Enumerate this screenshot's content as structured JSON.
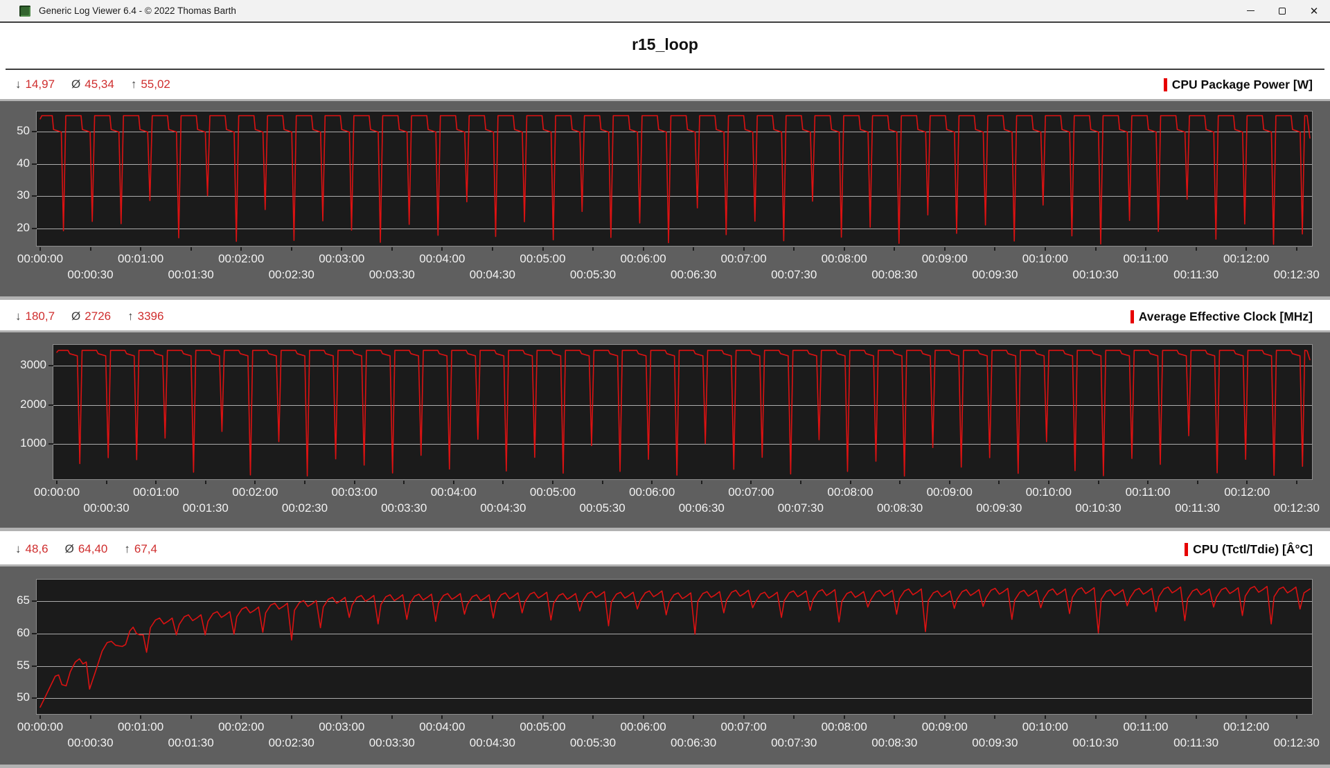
{
  "window": {
    "title": "Generic Log Viewer 6.4 - © 2022 Thomas Barth",
    "close_glyph": "✕"
  },
  "header": {
    "title": "r15_loop"
  },
  "stat_symbols": {
    "min": "↓",
    "avg": "Ø",
    "max": "↑"
  },
  "chart_data": [
    {
      "type": "line",
      "title": "CPU Package Power [W]",
      "stats": {
        "min": "14,97",
        "avg": "45,34",
        "max": "55,02"
      },
      "legend_color": "#e60000",
      "line_color": "#dc1212",
      "ylim": [
        14.5,
        56.3
      ],
      "yticks": [
        20,
        30,
        40,
        50
      ],
      "x_max_s": 758,
      "x_tick_interval_s": 30,
      "x_row1_labels": [
        "00:00:00",
        "00:01:00",
        "00:02:00",
        "00:03:00",
        "00:04:00",
        "00:05:00",
        "00:06:00",
        "00:07:00",
        "00:08:00",
        "00:09:00",
        "00:10:00",
        "00:11:00",
        "00:12:00"
      ],
      "x_row2_labels": [
        "00:00:30",
        "00:01:30",
        "00:02:30",
        "00:03:30",
        "00:04:30",
        "00:05:30",
        "00:06:30",
        "00:07:30",
        "00:08:30",
        "00:09:30",
        "00:10:30",
        "00:11:30",
        "00:12:30"
      ],
      "series": [
        {
          "name": "CPU Package Power",
          "lead": [
            [
              0,
              54.0
            ]
          ],
          "cycle": {
            "t0": 1.0,
            "period": 17.2,
            "count": 44,
            "shape": [
              [
                0,
                "c",
                55.0
              ],
              [
                6.2,
                "c",
                55.0
              ],
              [
                7.0,
                "c",
                50.7
              ],
              [
                11.6,
                "c",
                49.9
              ],
              [
                12.9,
                "d",
                0
              ],
              [
                14.3,
                "c",
                55.0
              ]
            ],
            "dips": [
              19.2,
              22.1,
              21.4,
              28.6,
              17.0,
              30.1,
              15.9,
              25.8,
              16.2,
              22.3,
              19.4,
              15.6,
              21.2,
              17.8,
              28.2,
              17.4,
              22.0,
              16.4,
              25.2,
              17.1,
              21.6,
              15.5,
              26.3,
              18.0,
              22.2,
              16.1,
              28.4,
              17.2,
              20.3,
              15.3,
              24.1,
              18.4,
              21.0,
              16.0,
              27.2,
              17.6,
              15.1,
              22.4,
              19.0,
              29.0,
              16.6,
              21.3,
              15.0,
              18.2
            ]
          },
          "tail": [
            [
              756.3,
              55.0
            ],
            [
              758,
              48.0
            ]
          ]
        }
      ]
    },
    {
      "type": "line",
      "title": "Average Effective Clock [MHz]",
      "stats": {
        "min": "180,7",
        "avg": "2726",
        "max": "3396"
      },
      "legend_color": "#e60000",
      "line_color": "#dc1212",
      "ylim": [
        100,
        3530
      ],
      "yticks": [
        1000,
        2000,
        3000
      ],
      "x_max_s": 758,
      "x_tick_interval_s": 30,
      "x_row1_labels": [
        "00:00:00",
        "00:01:00",
        "00:02:00",
        "00:03:00",
        "00:04:00",
        "00:05:00",
        "00:06:00",
        "00:07:00",
        "00:08:00",
        "00:09:00",
        "00:10:00",
        "00:11:00",
        "00:12:00"
      ],
      "x_row2_labels": [
        "00:00:30",
        "00:01:30",
        "00:02:30",
        "00:03:30",
        "00:04:30",
        "00:05:30",
        "00:06:30",
        "00:07:30",
        "00:08:30",
        "00:09:30",
        "00:10:30",
        "00:11:30",
        "00:12:30"
      ],
      "series": [
        {
          "name": "Average Effective Clock",
          "lead": [
            [
              0,
              3340
            ]
          ],
          "cycle": {
            "t0": 1.0,
            "period": 17.2,
            "count": 44,
            "shape": [
              [
                0,
                "c",
                3390
              ],
              [
                5.8,
                "c",
                3390
              ],
              [
                6.8,
                "c",
                3305
              ],
              [
                11.4,
                "c",
                3250
              ],
              [
                12.9,
                "d",
                0
              ],
              [
                14.3,
                "c",
                3390
              ]
            ],
            "dips": [
              500,
              650,
              600,
              1150,
              280,
              1320,
              210,
              1060,
              185,
              620,
              460,
              260,
              710,
              360,
              1120,
              310,
              660,
              255,
              960,
              300,
              610,
              205,
              1010,
              355,
              660,
              235,
              1110,
              300,
              560,
              181,
              910,
              410,
              650,
              250,
              1060,
              320,
              190,
              630,
              480,
              1210,
              265,
              610,
              200,
              430
            ]
          },
          "tail": [
            [
              756.3,
              3380
            ],
            [
              758,
              3150
            ]
          ]
        }
      ]
    },
    {
      "type": "line",
      "title": "CPU (Tctl/Tdie) [Â°C]",
      "stats": {
        "min": "48,6",
        "avg": "64,40",
        "max": "67,4"
      },
      "legend_color": "#e60000",
      "line_color": "#dc1212",
      "ylim": [
        47.55,
        68.35
      ],
      "yticks": [
        50,
        55,
        60,
        65
      ],
      "x_max_s": 758,
      "x_tick_interval_s": 30,
      "x_row1_labels": [
        "00:00:00",
        "00:01:00",
        "00:02:00",
        "00:03:00",
        "00:04:00",
        "00:05:00",
        "00:06:00",
        "00:07:00",
        "00:08:00",
        "00:09:00",
        "00:10:00",
        "00:11:00",
        "00:12:00"
      ],
      "x_row2_labels": [
        "00:00:30",
        "00:01:30",
        "00:02:30",
        "00:03:30",
        "00:04:30",
        "00:05:30",
        "00:06:30",
        "00:07:30",
        "00:08:30",
        "00:09:30",
        "00:10:30",
        "00:11:30",
        "00:12:30"
      ],
      "series": [
        {
          "name": "CPU (Tctl/Tdie)",
          "lead": [
            [
              0,
              48.6
            ],
            [
              3,
              50.2
            ],
            [
              6,
              51.8
            ],
            [
              9,
              53.4
            ],
            [
              11,
              53.6
            ],
            [
              13,
              52.1
            ],
            [
              15.5,
              51.9
            ],
            [
              18,
              54.1
            ],
            [
              21,
              55.6
            ],
            [
              23.5,
              56.1
            ],
            [
              25.5,
              55.3
            ],
            [
              27.5,
              55.6
            ],
            [
              29.5,
              51.4
            ],
            [
              33.5,
              54.5
            ],
            [
              37,
              57.3
            ],
            [
              40,
              58.6
            ],
            [
              42.5,
              58.8
            ],
            [
              45,
              58.2
            ],
            [
              47,
              58.1
            ],
            [
              49,
              58.0
            ],
            [
              51,
              58.3
            ],
            [
              53.5,
              60.4
            ],
            [
              55.5,
              61.0
            ],
            [
              57.5,
              60.0
            ],
            [
              59.5,
              59.8
            ],
            [
              61.5,
              59.8
            ],
            [
              63.5,
              57.1
            ]
          ],
          "cycle": {
            "t0": 69.8,
            "period": 17.2,
            "count": 40,
            "shape": [
              [
                -4,
                "p",
                -1.5
              ],
              [
                -1,
                "p",
                -0.3
              ],
              [
                1.5,
                "p",
                0
              ],
              [
                4,
                "p",
                -0.9
              ],
              [
                6.5,
                "p",
                -0.5
              ],
              [
                9,
                "p",
                0
              ],
              [
                11.5,
                "d",
                0
              ]
            ],
            "peaks": [
              62.4,
              62.9,
              63.4,
              64.1,
              64.7,
              65.1,
              65.6,
              65.9,
              66.0,
              66.1,
              66.2,
              66.0,
              66.3,
              66.4,
              66.2,
              66.5,
              66.4,
              66.6,
              66.3,
              66.5,
              66.7,
              66.4,
              66.6,
              66.8,
              66.5,
              66.7,
              66.9,
              66.6,
              66.8,
              67.0,
              66.7,
              66.9,
              67.1,
              66.8,
              67.0,
              67.2,
              66.9,
              67.1,
              67.3,
              67.2
            ],
            "dips": [
              59.8,
              59.8,
              59.9,
              60.2,
              59.0,
              60.9,
              62.5,
              61.5,
              62.2,
              61.9,
              63.0,
              62.4,
              63.2,
              62.1,
              63.5,
              61.2,
              63.8,
              62.9,
              59.9,
              63.2,
              64.0,
              62.5,
              63.6,
              61.8,
              64.1,
              63.0,
              60.3,
              63.9,
              64.2,
              62.2,
              64.0,
              63.1,
              60.1,
              64.3,
              63.4,
              62.0,
              64.1,
              62.8,
              61.5,
              63.8
            ]
          },
          "tail": [
            [
              754.5,
              66.3
            ],
            [
              758,
              66.9
            ]
          ]
        }
      ]
    }
  ]
}
